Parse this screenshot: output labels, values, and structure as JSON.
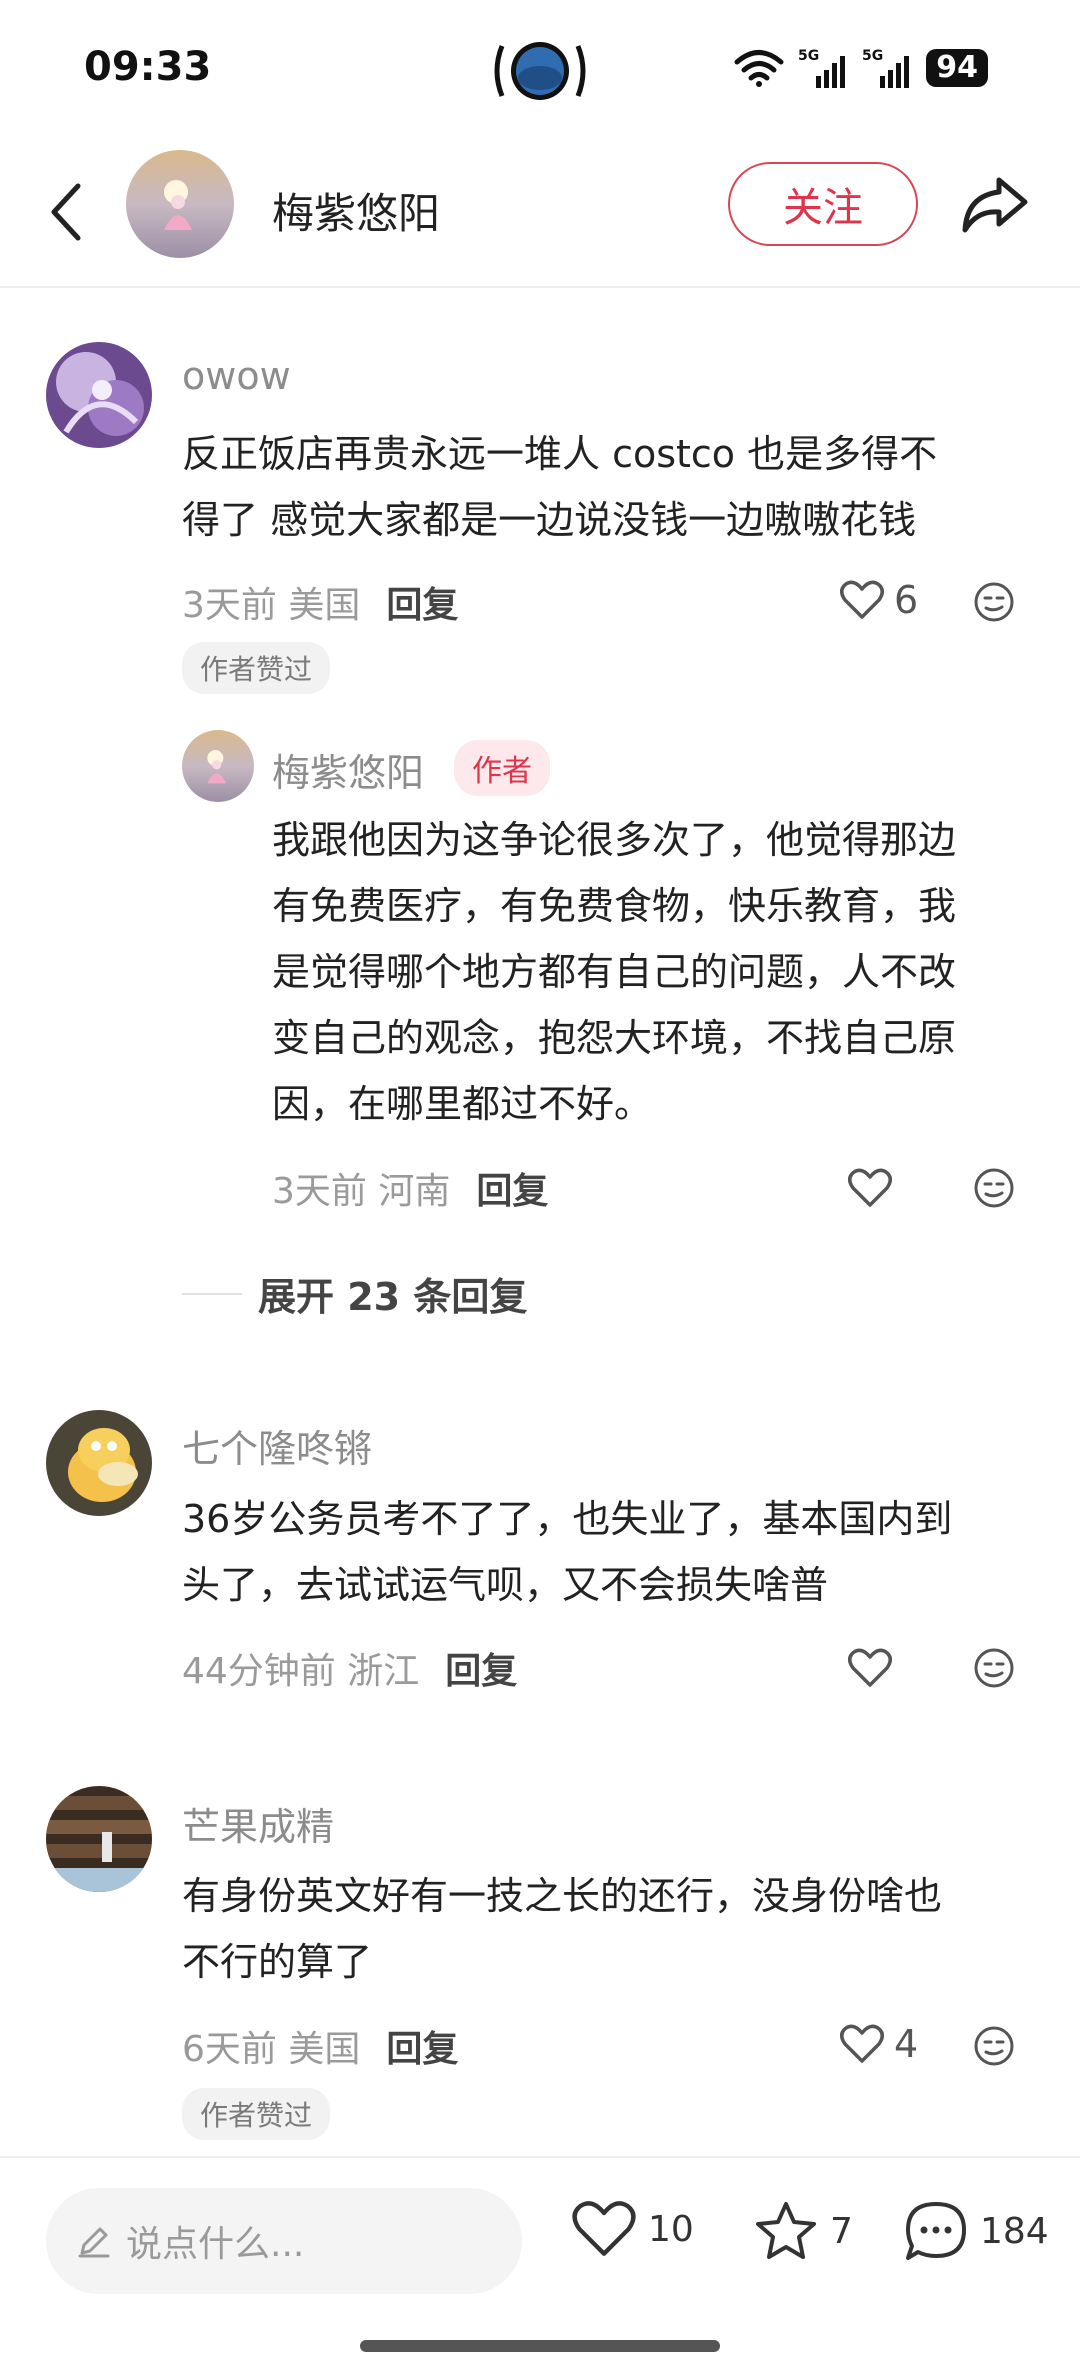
{
  "status": {
    "time": "09:33",
    "battery": "94",
    "network1": "5G",
    "network2": "5G"
  },
  "header": {
    "name": "梅紫悠阳",
    "follow_label": "关注"
  },
  "comments": [
    {
      "user": "owow",
      "text_lines": [
        "反正饭店再贵永远一堆人 costco 也是多得不",
        "得了 感觉大家都是一边说没钱一边嗷嗷花钱"
      ],
      "time": "3天前",
      "location": "美国",
      "reply_label": "回复",
      "likes": "6",
      "liked_badge": "作者赞过"
    },
    {
      "user": "七个隆咚锵",
      "text_lines": [
        "36岁公务员考不了了，也失业了，基本国内到",
        "头了，去试试运气呗，又不会损失啥普"
      ],
      "time": "44分钟前",
      "location": "浙江",
      "reply_label": "回复"
    },
    {
      "user": "芒果成精",
      "text_lines": [
        "有身份英文好有一技之长的还行，没身份啥也",
        "不行的算了"
      ],
      "time": "6天前",
      "location": "美国",
      "reply_label": "回复",
      "likes": "4",
      "liked_badge": "作者赞过"
    }
  ],
  "reply": {
    "user": "梅紫悠阳",
    "author_tag": "作者",
    "text_lines": [
      "我跟他因为这争论很多次了，他觉得那边",
      "有免费医疗，有免费食物，快乐教育，我",
      "是觉得哪个地方都有自己的问题，人不改",
      "变自己的观念，抱怨大环境，不找自己原",
      "因，在哪里都过不好。"
    ],
    "time": "3天前",
    "location": "河南",
    "reply_label": "回复"
  },
  "expand_label": "展开 23 条回复",
  "bottom": {
    "input_placeholder": "说点什么...",
    "likes": "10",
    "stars": "7",
    "comments": "184"
  },
  "colors": {
    "accent": "#e0344a",
    "text": "#222222",
    "muted": "#9a9a9a"
  },
  "icons": [
    "back-icon",
    "share-icon",
    "heart-icon",
    "emoji-icon",
    "pencil-icon",
    "star-icon",
    "comment-icon",
    "wifi-icon",
    "signal-icon"
  ]
}
